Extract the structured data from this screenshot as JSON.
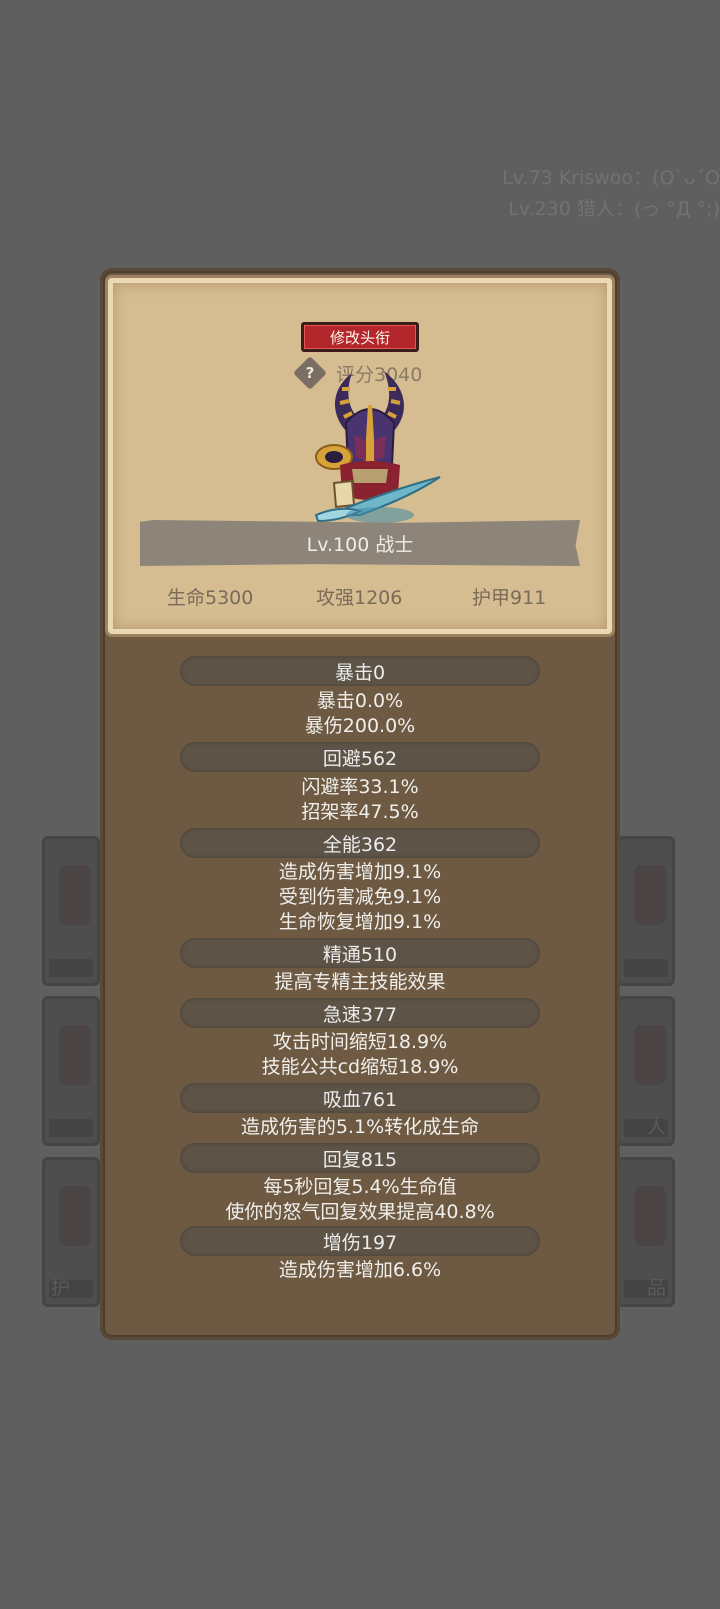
{
  "chat": {
    "line1": "Lv.73 Kriswoo：(ΟˋᴗˊΟ",
    "line2": "Lv.230 猎人：(っ °Д °;)"
  },
  "background_slots": {
    "left3_text": "护",
    "right2_text": "人",
    "right3_text": "品"
  },
  "card": {
    "title_button": "修改头衔",
    "help_icon": "?",
    "score": "评分3040",
    "level_class": "Lv.100 战士",
    "stats": {
      "hp": "生命5300",
      "attack": "攻强1206",
      "armor": "护甲911"
    }
  },
  "attributes": [
    {
      "name": "暴击0",
      "lines": [
        "暴击0.0%",
        "暴伤200.0%"
      ]
    },
    {
      "name": "回避562",
      "lines": [
        "闪避率33.1%",
        "招架率47.5%"
      ]
    },
    {
      "name": "全能362",
      "lines": [
        "造成伤害增加9.1%",
        "受到伤害减免9.1%",
        "生命恢复增加9.1%"
      ]
    },
    {
      "name": "精通510",
      "lines": [
        "提高专精主技能效果"
      ]
    },
    {
      "name": "急速377",
      "lines": [
        "攻击时间缩短18.9%",
        "技能公共cd缩短18.9%"
      ]
    },
    {
      "name": "吸血761",
      "lines": [
        "造成伤害的5.1%转化成生命"
      ]
    },
    {
      "name": "回复815",
      "lines": [
        "每5秒回复5.4%生命值",
        "使你的怒气回复效果提高40.8%"
      ]
    },
    {
      "name": "增伤197",
      "lines": [
        "造成伤害增加6.6%"
      ]
    }
  ],
  "colors": {
    "background": "#5f5f5f",
    "panel": "#6e5a42",
    "card": "#d6bd91",
    "title_button": "#b3262b",
    "attr_header": "#5d5347"
  }
}
